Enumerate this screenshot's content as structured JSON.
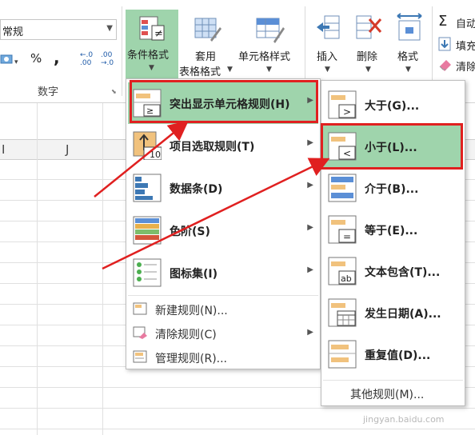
{
  "ribbon": {
    "number_format": "常规",
    "percent_symbol": "%",
    "comma_symbol": ",",
    "inc_decimal_top": "←.0",
    "inc_decimal_bottom": ".00",
    "dec_decimal_top": ".00",
    "dec_decimal_bottom": "→.0",
    "group_number_label": "数字",
    "cond_format_label": "条件格式",
    "table_format_line1": "套用",
    "table_format_line2": "表格格式",
    "cell_style_label": "单元格样式",
    "insert_label": "插入",
    "delete_label": "删除",
    "format_label": "格式",
    "autosum_label": "自动",
    "fill_label": "填充",
    "clear_label": "清除",
    "sigma": "Σ"
  },
  "sheet": {
    "col_I": "I",
    "col_J": "J"
  },
  "main_menu": {
    "items": [
      {
        "label": "突出显示单元格规则(H)"
      },
      {
        "label": "项目选取规则(T)"
      },
      {
        "label": "数据条(D)"
      },
      {
        "label": "色阶(S)"
      },
      {
        "label": "图标集(I)"
      }
    ],
    "small_items": [
      {
        "label": "新建规则(N)..."
      },
      {
        "label": "清除规则(C)"
      },
      {
        "label": "管理规则(R)..."
      }
    ],
    "icon_10": "10"
  },
  "sub_menu": {
    "items": [
      {
        "label": "大于(G)..."
      },
      {
        "label": "小于(L)..."
      },
      {
        "label": "介于(B)..."
      },
      {
        "label": "等于(E)..."
      },
      {
        "label": "文本包含(T)..."
      },
      {
        "label": "发生日期(A)..."
      },
      {
        "label": "重复值(D)..."
      }
    ],
    "other_rules": "其他规则(M)...",
    "gt_sym": ">",
    "lt_sym": "<",
    "eq_sym": "=",
    "ab_sym": "ab"
  },
  "watermark": "jingyan.baidu.com",
  "colors": {
    "highlight": "#9fd4ac",
    "annotation_red": "#e02020"
  }
}
